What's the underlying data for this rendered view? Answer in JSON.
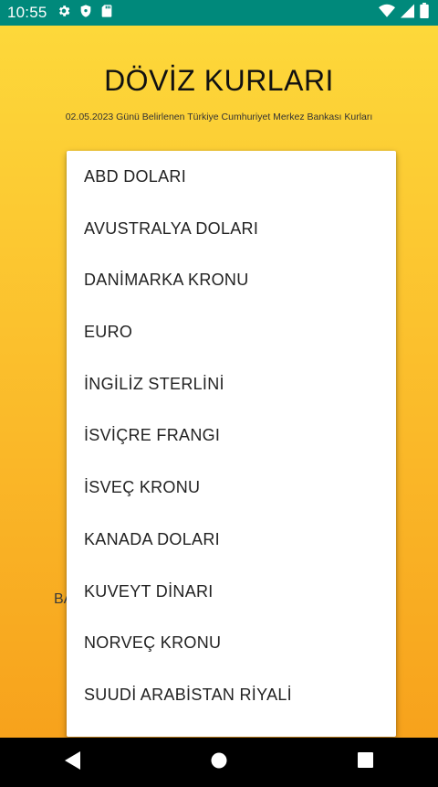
{
  "status_bar": {
    "time": "10:55",
    "left_icons": [
      "settings-icon",
      "shield-icon",
      "sd-card-icon"
    ],
    "right_icons": [
      "wifi-icon",
      "cell-signal-icon",
      "battery-icon"
    ]
  },
  "header": {
    "title": "DÖVİZ KURLARI",
    "subtitle": "02.05.2023 Günü Belirlenen Türkiye Cumhuriyet Merkez Bankası Kurları"
  },
  "background_partial_text": "BA",
  "dropdown": {
    "items": [
      "ABD DOLARI",
      "AVUSTRALYA DOLARI",
      "DANİMARKA KRONU",
      "EURO",
      "İNGİLİZ STERLİNİ",
      "İSVİÇRE FRANGI",
      "İSVEÇ KRONU",
      "KANADA DOLARI",
      "KUVEYT DİNARI",
      "NORVEÇ KRONU",
      "SUUDİ ARABİSTAN RİYALİ"
    ]
  },
  "nav_bar": {
    "buttons": [
      "back-icon",
      "home-icon",
      "recents-icon"
    ]
  },
  "colors": {
    "status_bar": "#00897b",
    "gradient_top": "#fdd83a",
    "gradient_bottom": "#f7a21c",
    "dropdown_bg": "#ffffff"
  }
}
